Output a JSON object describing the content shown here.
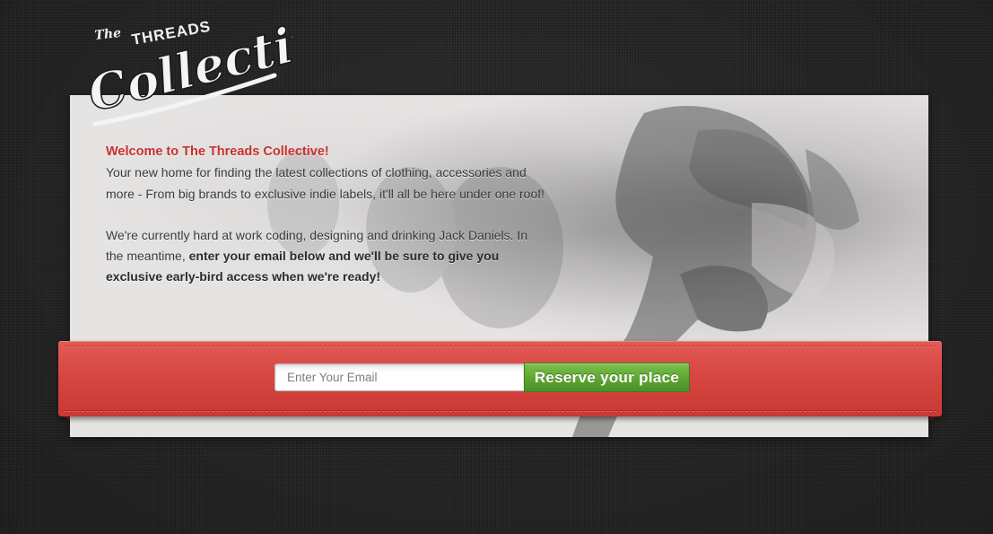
{
  "brand": {
    "logo_alt": "The Threads Collective",
    "logo_the": "The",
    "logo_threads": "THREADS",
    "logo_collective": "Collective"
  },
  "intro": {
    "welcome": "Welcome to The Threads Collective!",
    "paragraph1": "Your new home for finding the latest collections of clothing, accessories and more - From big brands to exclusive indie labels, it'll all be here under one roof!",
    "paragraph2_plain": "We're currently hard at work coding, designing and drinking Jack Daniels. In the meantime, ",
    "paragraph2_bold": "enter your email below and we'll be sure to give you exclusive early-bird access when we're ready!"
  },
  "signup": {
    "email_placeholder": "Enter Your Email",
    "email_value": "",
    "button_label": "Reserve your place"
  },
  "colors": {
    "background": "#262626",
    "card": "#e6e4e3",
    "ribbon": "#d84844",
    "welcome_text": "#c8302e",
    "button_green": "#5ea532"
  }
}
